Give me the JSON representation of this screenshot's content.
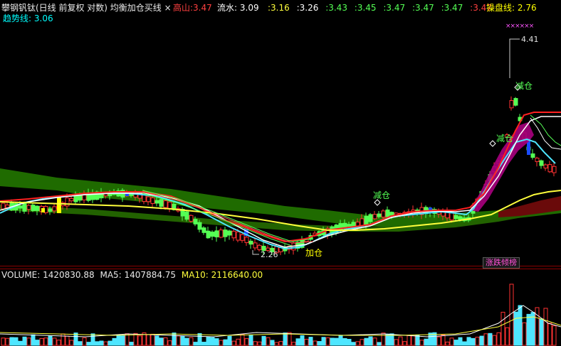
{
  "header": {
    "title": "攀钢钒钛(日线 前复权 对数) 均衡加仓买线",
    "close_symbol": "×",
    "gaoshan_label": "高山:",
    "gaoshan_value": "3.47",
    "liushui_label": "流水:",
    "liushui_value": "3.09",
    "series_values": [
      ":3.16",
      ":3.26",
      ":3.43",
      ":3.45",
      ":3.47",
      ":3.47",
      ":3.47",
      ":3.47"
    ],
    "caopan_label": "操盘线:",
    "caopan_value": "2.76",
    "qushi_label": "趋势线:",
    "qushi_value": "3.06"
  },
  "annotations": {
    "high_price": "4.41",
    "low_price": "2.26",
    "add_position": "加仓",
    "reduce_positions": [
      "减仓",
      "减仓",
      "减仓"
    ],
    "cross_marks": "××××××"
  },
  "button": {
    "zhangdie_label": "涨跌倾榜"
  },
  "volume": {
    "label": "VOLUME: 1420830.88",
    "ma5": "MA5: 1407884.75",
    "ma10": "MA10: 2116640.00"
  },
  "colors": {
    "up": "#ff3232",
    "down": "#54ff54",
    "ribbon": "#2a7a00",
    "trend": "#ffff3c",
    "cyan": "#4ee6ff",
    "magenta": "#b4008c",
    "label_yellow": "#ffff00",
    "label_cyan": "#00ffff"
  }
}
